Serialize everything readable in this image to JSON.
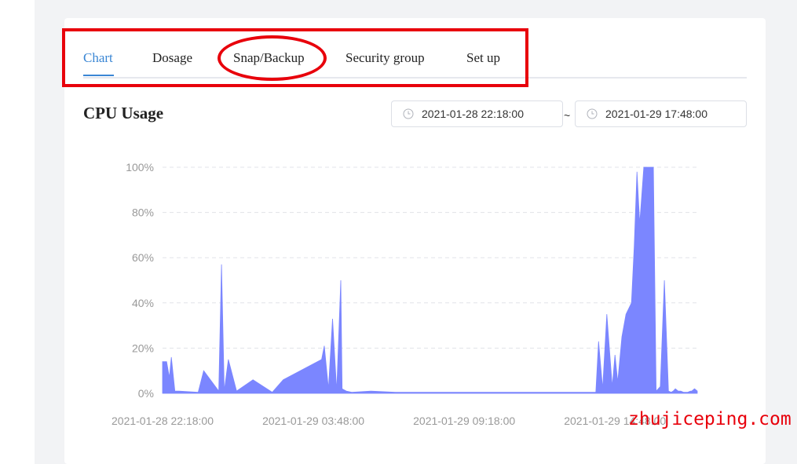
{
  "tabs": [
    {
      "label": "Chart",
      "active": true
    },
    {
      "label": "Dosage",
      "active": false
    },
    {
      "label": "Snap/Backup",
      "active": false
    },
    {
      "label": "Security group",
      "active": false
    },
    {
      "label": "Set up",
      "active": false
    }
  ],
  "title": "CPU Usage",
  "date_range": {
    "start": "2021-01-28 22:18:00",
    "separator": "~",
    "end": "2021-01-29 17:48:00",
    "icon": "clock-icon"
  },
  "watermark": "zhujiceping.com",
  "colors": {
    "accent": "#3a86d4",
    "area_fill": "#7b86ff",
    "annotation": "#e8000b"
  },
  "chart_data": {
    "type": "area",
    "title": "",
    "xlabel": "",
    "ylabel": "",
    "ylim": [
      0,
      100
    ],
    "grid": true,
    "y_ticks": [
      "0%",
      "20%",
      "40%",
      "60%",
      "80%",
      "100%"
    ],
    "x_ticks": [
      "2021-01-28 22:18:00",
      "2021-01-29 03:48:00",
      "2021-01-29 09:18:00",
      "2021-01-29 14:48:00"
    ],
    "x_hours": [
      0,
      0.15,
      0.25,
      0.32,
      0.45,
      0.6,
      1.3,
      1.5,
      2.05,
      2.15,
      2.25,
      2.4,
      2.7,
      3.3,
      4.0,
      4.4,
      5.8,
      5.9,
      6.05,
      6.2,
      6.35,
      6.5,
      6.55,
      6.7,
      6.9,
      7.6,
      8.5,
      11.0,
      14.0,
      15.8,
      15.9,
      16.05,
      16.2,
      16.4,
      16.5,
      16.6,
      16.75,
      16.9,
      17.1,
      17.2,
      17.3,
      17.4,
      17.55,
      17.7,
      17.8,
      17.9,
      18.0,
      18.15,
      18.3,
      18.45,
      18.55,
      18.62,
      18.7,
      18.8,
      18.9,
      19.0,
      19.15,
      19.25,
      19.3,
      19.4,
      19.5
    ],
    "values": [
      14,
      14,
      7,
      16,
      1,
      1,
      0.5,
      10,
      1,
      57,
      1,
      15,
      1,
      6,
      0.5,
      6,
      15,
      21,
      2,
      33,
      1,
      50,
      2,
      1,
      0.5,
      1,
      0.5,
      0.5,
      0.5,
      0.5,
      23,
      2,
      35,
      3,
      17,
      5,
      25,
      35,
      40,
      65,
      98,
      75,
      100,
      100,
      100,
      100,
      1,
      3,
      50,
      1,
      0.5,
      1,
      2,
      1,
      1,
      0.5,
      0.5,
      1,
      1,
      2,
      1
    ]
  }
}
